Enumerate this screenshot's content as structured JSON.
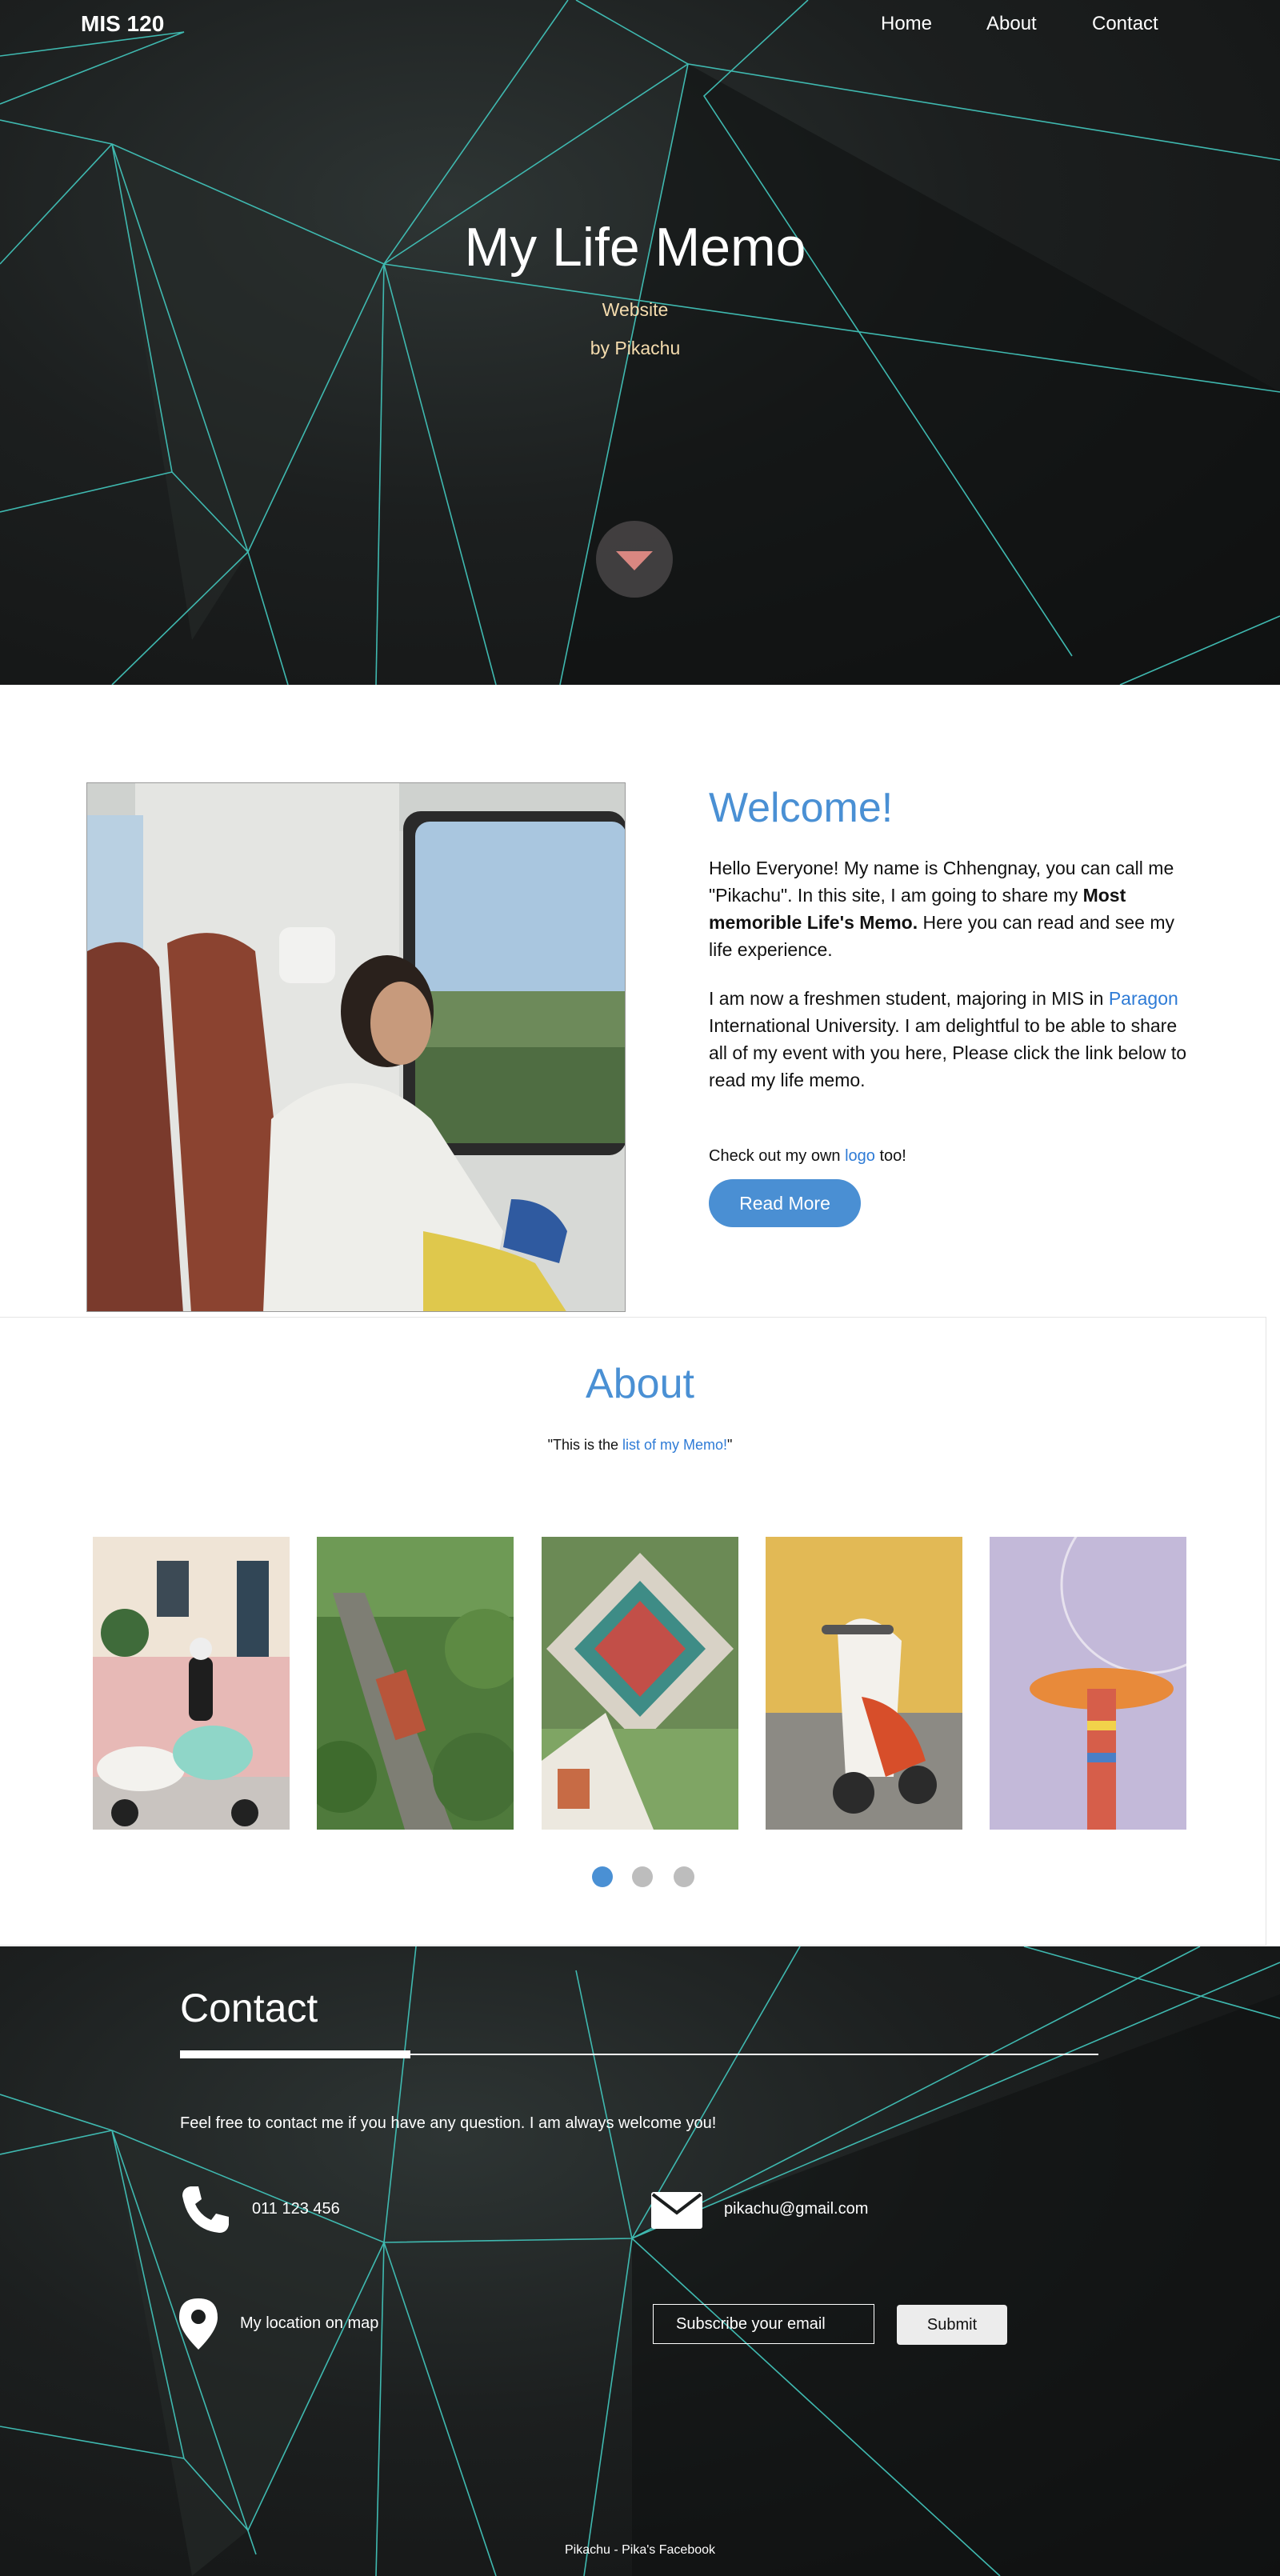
{
  "nav": {
    "brand": "MIS 120",
    "links": [
      "Home",
      "About",
      "Contact"
    ]
  },
  "hero": {
    "title": "My Life Memo",
    "subtitle": "Website",
    "byline": "by Pikachu"
  },
  "welcome": {
    "title": "Welcome!",
    "p1_a": "Hello Everyone! My name is Chhengnay, you can call me \"Pikachu\". In this site, I am going to share my ",
    "p1_bold": "Most memorible Life's Memo.",
    "p1_b": " Here you can read and see my life experience.",
    "p2_a": "I am now a freshmen student, majoring in MIS in ",
    "p2_link": "Paragon",
    "p2_b": " International University. I am delightful to be able to share all of my event with you here, Please click the link below to read my life memo.",
    "note_a": "Check out my own ",
    "note_link": "logo",
    "note_b": " too!",
    "button": "Read More"
  },
  "about": {
    "title": "About",
    "quote_a": "\"This is the ",
    "quote_link": "list of my Memo!",
    "quote_b": "\"",
    "carousel_active": 0,
    "carousel_count": 3
  },
  "contact": {
    "title": "Contact",
    "text": "Feel free to contact me if you have any question. I am always welcome you!",
    "phone": "011 123 456",
    "email": "pikachu@gmail.com",
    "location": "My location on map",
    "email_placeholder": "Subscribe your email",
    "submit": "Submit",
    "footer": "Pikachu - Pika's Facebook"
  },
  "colors": {
    "accent": "#4a90d4",
    "link": "#2e7bd6",
    "mesh": "#3fb9b0",
    "subtitle": "#f5dcae"
  }
}
